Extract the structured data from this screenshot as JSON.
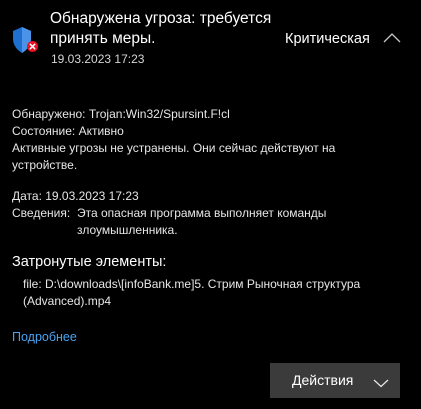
{
  "header": {
    "title": "Обнаружена угроза: требуется принять меры.",
    "timestamp": "19.03.2023 17:23",
    "severity": "Критическая",
    "shield_icon": "shield-alert-icon",
    "collapse_icon": "chevron-up-icon",
    "accent_color": "#1e6fd0",
    "alert_color": "#e81123"
  },
  "details": {
    "detected_label": "Обнаружено:",
    "detected_value": "Trojan:Win32/Spursint.F!cl",
    "status_label": "Состояние:",
    "status_value": "Активно",
    "status_message": "Активные угрозы не устранены. Они сейчас действуют на устройстве.",
    "date_label": "Дата:",
    "date_value": "19.03.2023 17:23",
    "info_label": "Сведения:",
    "info_value": "Эта опасная программа выполняет команды злоумышленника."
  },
  "affected": {
    "title": "Затронутые элементы:",
    "items": [
      "file: D:\\downloads\\[infoBank.me]5. Стрим Рыночная структура (Advanced).mp4"
    ]
  },
  "more_link": "Подробнее",
  "actions_button": {
    "label": "Действия",
    "icon": "chevron-down-icon"
  }
}
